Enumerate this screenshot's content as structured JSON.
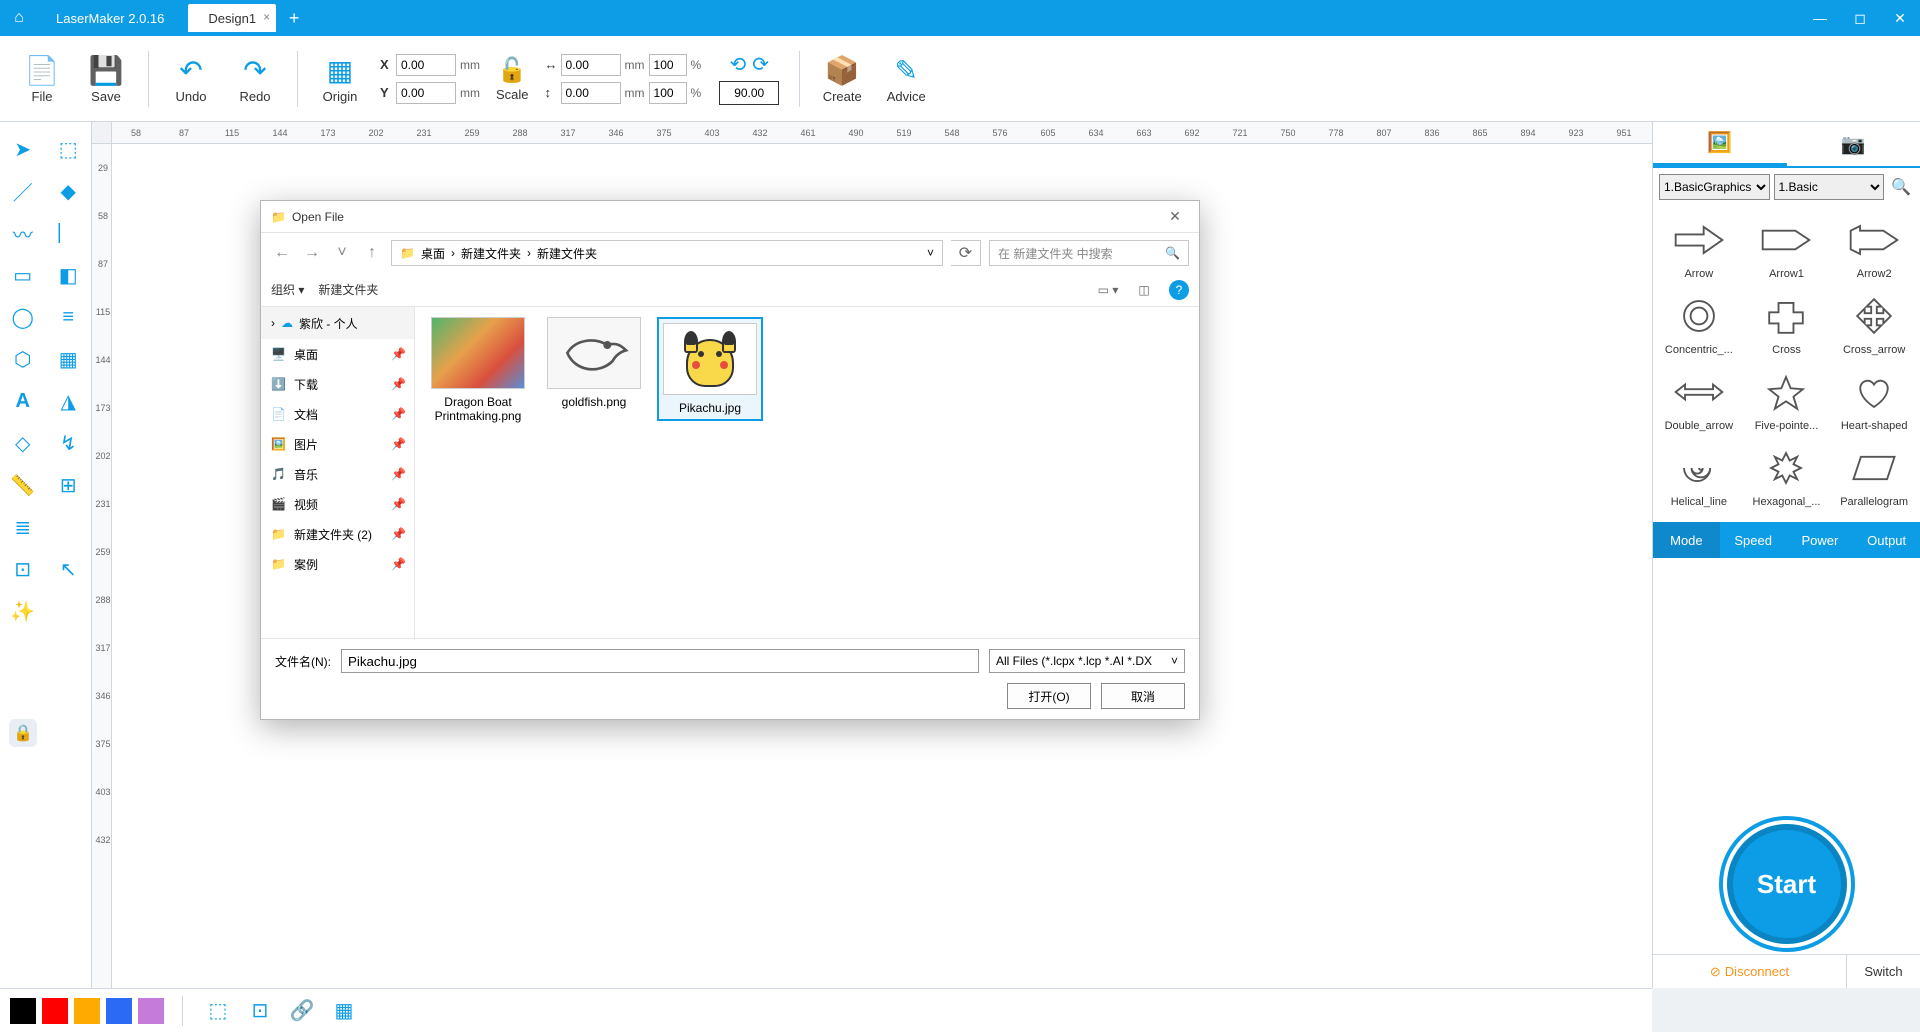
{
  "app": {
    "title": "LaserMaker 2.0.16",
    "tab": "Design1"
  },
  "toolbar": {
    "file": "File",
    "save": "Save",
    "undo": "Undo",
    "redo": "Redo",
    "origin": "Origin",
    "scale": "Scale",
    "create": "Create",
    "advice": "Advice",
    "x": "X",
    "y": "Y",
    "xval": "0.00",
    "yval": "0.00",
    "mm": "mm",
    "wval": "0.00",
    "hval": "0.00",
    "wpct": "100",
    "hpct": "100",
    "pct": "%",
    "rot": "90.00"
  },
  "ruler_h": [
    "58",
    "87",
    "115",
    "144",
    "173",
    "202",
    "231",
    "259",
    "288",
    "317",
    "346",
    "375",
    "403",
    "432",
    "461",
    "490",
    "519",
    "548",
    "576",
    "605",
    "634",
    "663",
    "692",
    "721",
    "750",
    "778",
    "807",
    "836",
    "865",
    "894",
    "923",
    "951"
  ],
  "ruler_v": [
    "29",
    "58",
    "87",
    "115",
    "144",
    "173",
    "202",
    "231",
    "259",
    "288",
    "317",
    "346",
    "375",
    "403",
    "432"
  ],
  "right": {
    "sel1": "1.BasicGraphics",
    "sel2": "1.Basic",
    "shapes": [
      "Arrow",
      "Arrow1",
      "Arrow2",
      "Concentric_...",
      "Cross",
      "Cross_arrow",
      "Double_arrow",
      "Five-pointe...",
      "Heart-shaped",
      "Helical_line",
      "Hexagonal_...",
      "Parallelogram"
    ],
    "mode": "Mode",
    "speed": "Speed",
    "power": "Power",
    "output": "Output",
    "start": "Start",
    "disconnect": "Disconnect",
    "switch": "Switch"
  },
  "colors": [
    "#000000",
    "#ff0000",
    "#ffaa00",
    "#2a6af4",
    "#c47bd9"
  ],
  "dialog": {
    "title": "Open File",
    "path_root": "桌面",
    "path_p1": "新建文件夹",
    "path_p2": "新建文件夹",
    "search_ph": "在 新建文件夹 中搜索",
    "organize": "组织",
    "newfolder": "新建文件夹",
    "side_header": "紫欣 - 个人",
    "side": [
      {
        "i": "🖥️",
        "l": "桌面"
      },
      {
        "i": "⬇️",
        "l": "下载"
      },
      {
        "i": "📄",
        "l": "文档"
      },
      {
        "i": "🖼️",
        "l": "图片"
      },
      {
        "i": "🎵",
        "l": "音乐"
      },
      {
        "i": "🎬",
        "l": "视频"
      },
      {
        "i": "📁",
        "l": "新建文件夹 (2)"
      },
      {
        "i": "📁",
        "l": "案例"
      }
    ],
    "files": [
      {
        "name": "Dragon Boat Printmaking.png"
      },
      {
        "name": "goldfish.png"
      },
      {
        "name": "Pikachu.jpg"
      }
    ],
    "fn_label": "文件名(N):",
    "fn_value": "Pikachu.jpg",
    "filter": "All Files (*.lcpx *.lcp *.AI *.DX",
    "open": "打开(O)",
    "cancel": "取消"
  }
}
